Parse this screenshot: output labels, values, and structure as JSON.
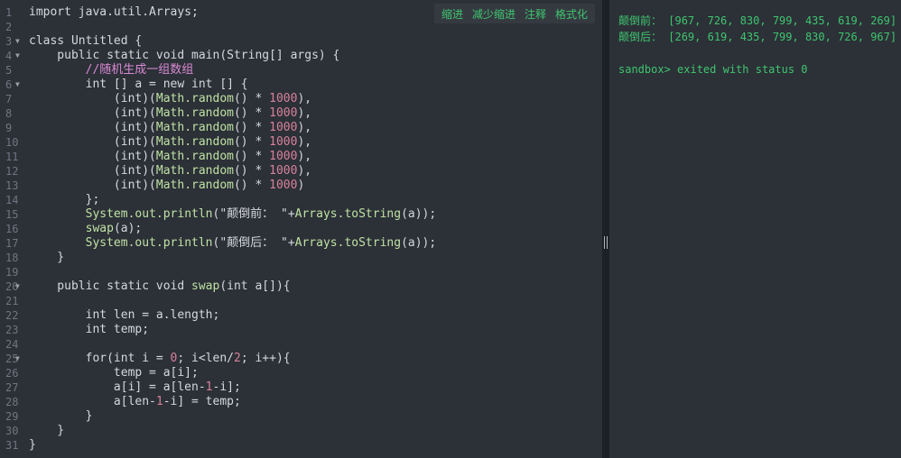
{
  "toolbar": {
    "indent": "缩进",
    "outdent": "减少缩进",
    "comment": "注释",
    "format": "格式化"
  },
  "gutter": [
    {
      "n": "1",
      "fold": false
    },
    {
      "n": "2",
      "fold": false
    },
    {
      "n": "3",
      "fold": true
    },
    {
      "n": "4",
      "fold": true
    },
    {
      "n": "5",
      "fold": false
    },
    {
      "n": "6",
      "fold": true
    },
    {
      "n": "7",
      "fold": false
    },
    {
      "n": "8",
      "fold": false
    },
    {
      "n": "9",
      "fold": false
    },
    {
      "n": "10",
      "fold": false
    },
    {
      "n": "11",
      "fold": false
    },
    {
      "n": "12",
      "fold": false
    },
    {
      "n": "13",
      "fold": false
    },
    {
      "n": "14",
      "fold": false
    },
    {
      "n": "15",
      "fold": false
    },
    {
      "n": "16",
      "fold": false
    },
    {
      "n": "17",
      "fold": false
    },
    {
      "n": "18",
      "fold": false
    },
    {
      "n": "19",
      "fold": false
    },
    {
      "n": "20",
      "fold": true
    },
    {
      "n": "21",
      "fold": false
    },
    {
      "n": "22",
      "fold": false
    },
    {
      "n": "23",
      "fold": false
    },
    {
      "n": "24",
      "fold": false
    },
    {
      "n": "25",
      "fold": true
    },
    {
      "n": "26",
      "fold": false
    },
    {
      "n": "27",
      "fold": false
    },
    {
      "n": "28",
      "fold": false
    },
    {
      "n": "29",
      "fold": false
    },
    {
      "n": "30",
      "fold": false
    },
    {
      "n": "31",
      "fold": false
    }
  ],
  "code_lines": [
    [
      [
        "t",
        "import java.util.Arrays;"
      ]
    ],
    [],
    [
      [
        "t",
        "class Untitled {"
      ]
    ],
    [
      [
        "t",
        "    public static void main(String[] args) {"
      ]
    ],
    [
      [
        "cm",
        "        //随机生成一组数组"
      ]
    ],
    [
      [
        "t",
        "        int [] a = new int [] {"
      ]
    ],
    [
      [
        "t",
        "            (int)("
      ],
      [
        "fn",
        "Math.random"
      ],
      [
        "t",
        "() * "
      ],
      [
        "num",
        "1000"
      ],
      [
        "t",
        "),"
      ]
    ],
    [
      [
        "t",
        "            (int)("
      ],
      [
        "fn",
        "Math.random"
      ],
      [
        "t",
        "() * "
      ],
      [
        "num",
        "1000"
      ],
      [
        "t",
        "),"
      ]
    ],
    [
      [
        "t",
        "            (int)("
      ],
      [
        "fn",
        "Math.random"
      ],
      [
        "t",
        "() * "
      ],
      [
        "num",
        "1000"
      ],
      [
        "t",
        "),"
      ]
    ],
    [
      [
        "t",
        "            (int)("
      ],
      [
        "fn",
        "Math.random"
      ],
      [
        "t",
        "() * "
      ],
      [
        "num",
        "1000"
      ],
      [
        "t",
        "),"
      ]
    ],
    [
      [
        "t",
        "            (int)("
      ],
      [
        "fn",
        "Math.random"
      ],
      [
        "t",
        "() * "
      ],
      [
        "num",
        "1000"
      ],
      [
        "t",
        "),"
      ]
    ],
    [
      [
        "t",
        "            (int)("
      ],
      [
        "fn",
        "Math.random"
      ],
      [
        "t",
        "() * "
      ],
      [
        "num",
        "1000"
      ],
      [
        "t",
        "),"
      ]
    ],
    [
      [
        "t",
        "            (int)("
      ],
      [
        "fn",
        "Math.random"
      ],
      [
        "t",
        "() * "
      ],
      [
        "num",
        "1000"
      ],
      [
        "t",
        ")"
      ]
    ],
    [
      [
        "t",
        "        };"
      ]
    ],
    [
      [
        "t",
        "        "
      ],
      [
        "fn",
        "System.out.println"
      ],
      [
        "t",
        "(\"颠倒前： \"+"
      ],
      [
        "fn",
        "Arrays.toString"
      ],
      [
        "t",
        "(a));"
      ]
    ],
    [
      [
        "t",
        "        "
      ],
      [
        "fn",
        "swap"
      ],
      [
        "t",
        "(a);"
      ]
    ],
    [
      [
        "t",
        "        "
      ],
      [
        "fn",
        "System.out.println"
      ],
      [
        "t",
        "(\"颠倒后： \"+"
      ],
      [
        "fn",
        "Arrays.toString"
      ],
      [
        "t",
        "(a));"
      ]
    ],
    [
      [
        "t",
        "    }"
      ]
    ],
    [],
    [
      [
        "t",
        "    public static void "
      ],
      [
        "fn",
        "swap"
      ],
      [
        "t",
        "(int a[]){"
      ]
    ],
    [],
    [
      [
        "t",
        "        int len = a.length;"
      ]
    ],
    [
      [
        "t",
        "        int temp;"
      ]
    ],
    [],
    [
      [
        "t",
        "        for(int i = "
      ],
      [
        "num",
        "0"
      ],
      [
        "t",
        "; i<len/"
      ],
      [
        "num",
        "2"
      ],
      [
        "t",
        "; i++){"
      ]
    ],
    [
      [
        "t",
        "            temp = a[i];"
      ]
    ],
    [
      [
        "t",
        "            a[i] = a[len-"
      ],
      [
        "num",
        "1"
      ],
      [
        "t",
        "-i];"
      ]
    ],
    [
      [
        "t",
        "            a[len-"
      ],
      [
        "num",
        "1"
      ],
      [
        "t",
        "-i] = temp;"
      ]
    ],
    [
      [
        "t",
        "        }"
      ]
    ],
    [
      [
        "t",
        "    }"
      ]
    ],
    [
      [
        "t",
        "}"
      ]
    ]
  ],
  "console": {
    "before_label": "颠倒前：",
    "before_value": " [967, 726, 830, 799, 435, 619, 269]",
    "after_label": "颠倒后：",
    "after_value": " [269, 619, 435, 799, 830, 726, 967]",
    "status": "sandbox> exited with status 0"
  },
  "colors": {
    "accent_green": "#3fc56f",
    "editor_bg": "#2c3037",
    "number": "#d6829a",
    "function": "#bfe2a4",
    "comment": "#d88ad4"
  }
}
